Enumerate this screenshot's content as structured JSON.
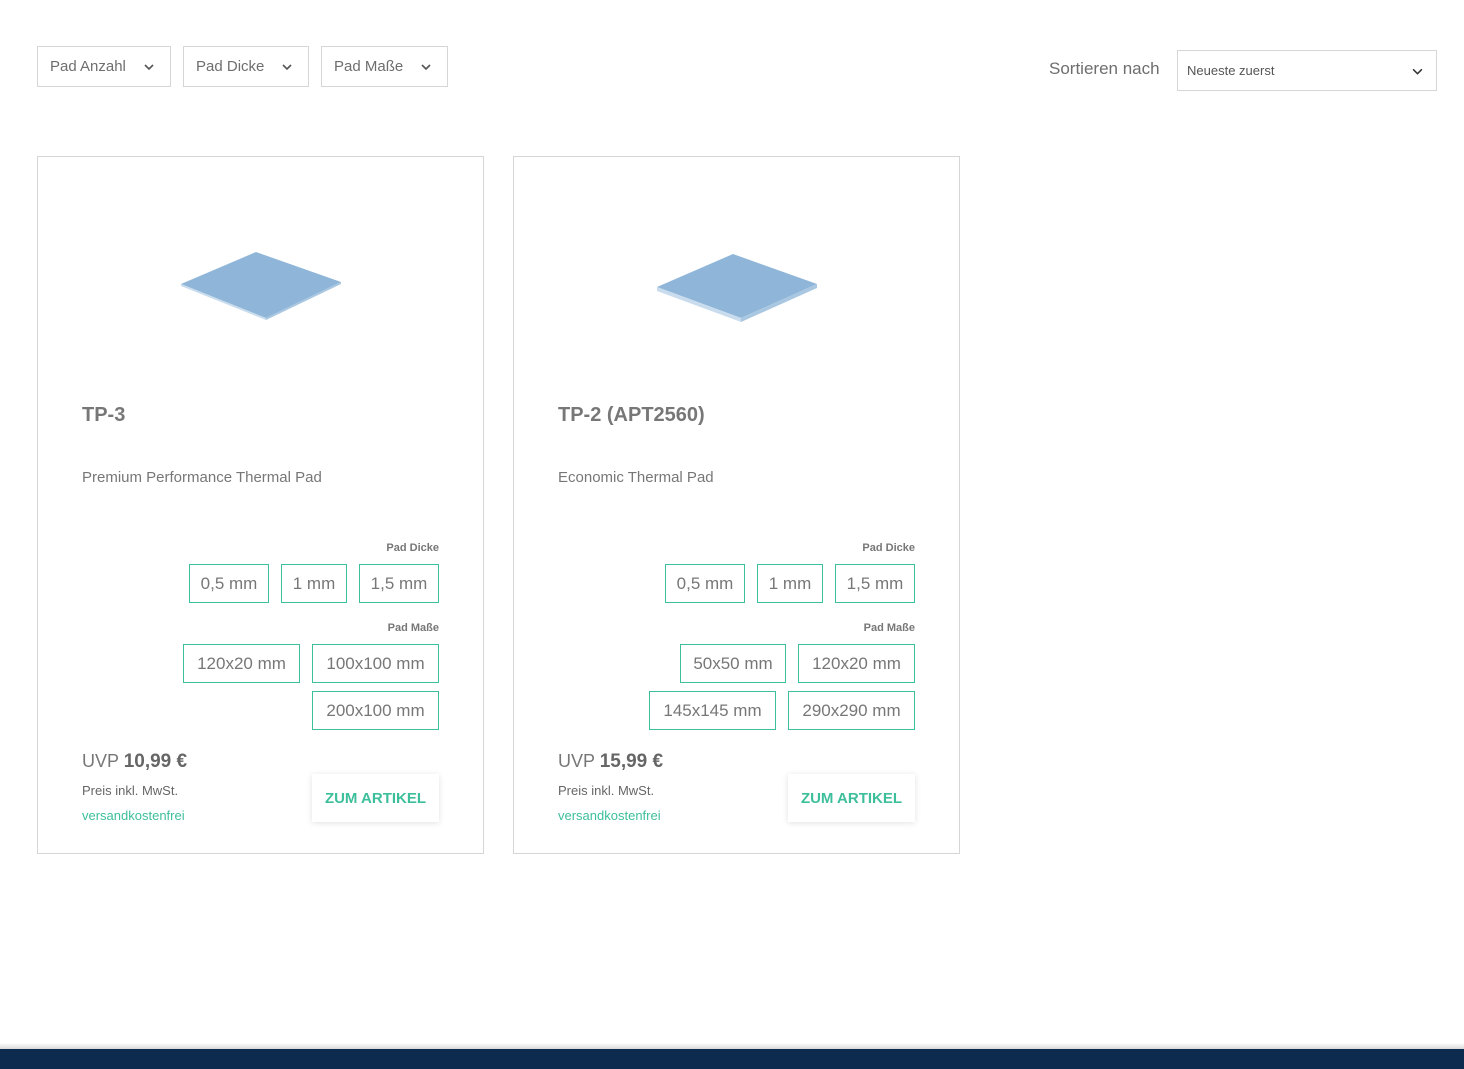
{
  "filters": {
    "pad_anzahl": "Pad Anzahl",
    "pad_dicke": "Pad Dicke",
    "pad_masse": "Pad Maße"
  },
  "sort": {
    "label": "Sortieren nach",
    "selected": "Neueste zuerst"
  },
  "products": [
    {
      "title": "TP-3",
      "subtitle": "Premium Performance Thermal Pad",
      "thickness_label": "Pad Dicke",
      "thickness_options": [
        "0,5 mm",
        "1 mm",
        "1,5 mm"
      ],
      "size_label": "Pad Maße",
      "size_options": [
        "120x20 mm",
        "100x100 mm",
        "200x100 mm"
      ],
      "price_prefix": "UVP",
      "price": "10,99 €",
      "tax_note": "Preis inkl. MwSt.",
      "shipping": "versandkostenfrei",
      "cta": "ZUM ARTIKEL"
    },
    {
      "title": "TP-2 (APT2560)",
      "subtitle": "Economic Thermal Pad",
      "thickness_label": "Pad Dicke",
      "thickness_options": [
        "0,5 mm",
        "1 mm",
        "1,5 mm"
      ],
      "size_label": "Pad Maße",
      "size_options": [
        "50x50 mm",
        "120x20 mm",
        "145x145 mm",
        "290x290 mm"
      ],
      "price_prefix": "UVP",
      "price": "15,99 €",
      "tax_note": "Preis inkl. MwSt.",
      "shipping": "versandkostenfrei",
      "cta": "ZUM ARTIKEL"
    }
  ],
  "colors": {
    "accent": "#3dbf9c",
    "border": "#d6d6d6",
    "footer": "#0d2b4e",
    "pad": "#8fb6d8"
  }
}
